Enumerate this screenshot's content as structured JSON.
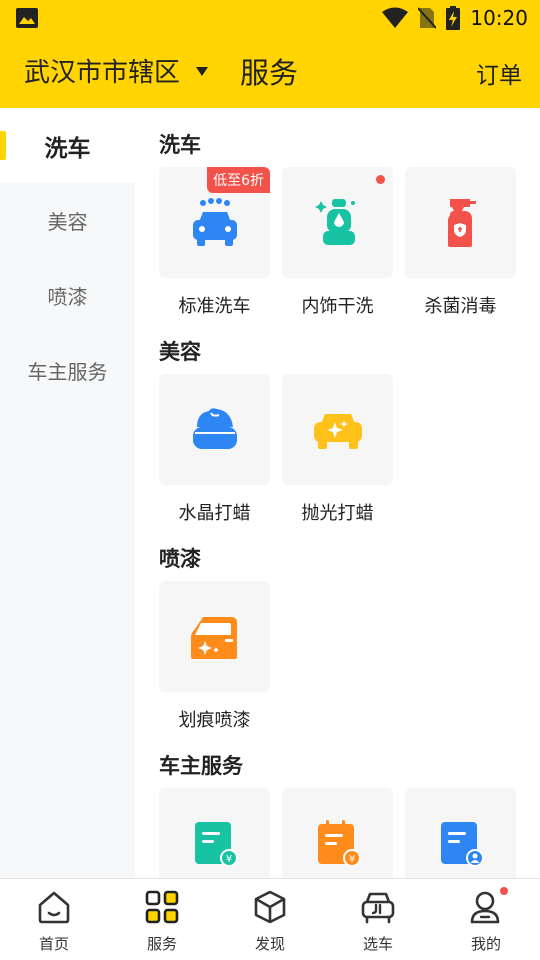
{
  "status_bar": {
    "time": "10:20"
  },
  "header": {
    "city": "武汉市市辖区",
    "title": "服务",
    "orders": "订单"
  },
  "sidebar": {
    "items": [
      {
        "label": "洗车",
        "active": true
      },
      {
        "label": "美容",
        "active": false
      },
      {
        "label": "喷漆",
        "active": false
      },
      {
        "label": "车主服务",
        "active": false
      }
    ]
  },
  "sections": [
    {
      "title": "洗车",
      "items": [
        {
          "label": "标准洗车",
          "badge": "低至6折",
          "icon": "car-wash-icon"
        },
        {
          "label": "内饰干洗",
          "icon": "car-seat-icon"
        },
        {
          "label": "杀菌消毒",
          "icon": "disinfect-spray-icon"
        }
      ]
    },
    {
      "title": "美容",
      "items": [
        {
          "label": "水晶打蜡",
          "icon": "wax-jar-icon"
        },
        {
          "label": "抛光打蜡",
          "icon": "polish-car-icon"
        }
      ]
    },
    {
      "title": "喷漆",
      "items": [
        {
          "label": "划痕喷漆",
          "icon": "car-door-paint-icon"
        }
      ]
    },
    {
      "title": "车主服务",
      "items": [
        {
          "label": "",
          "icon": "invoice-green-icon"
        },
        {
          "label": "",
          "icon": "invoice-orange-icon"
        },
        {
          "label": "",
          "icon": "profile-doc-icon"
        }
      ]
    }
  ],
  "bottom_nav": [
    {
      "label": "首页",
      "icon": "home-icon"
    },
    {
      "label": "服务",
      "icon": "grid-icon",
      "active": true
    },
    {
      "label": "发现",
      "icon": "cube-icon"
    },
    {
      "label": "选车",
      "icon": "car-select-icon"
    },
    {
      "label": "我的",
      "icon": "profile-icon",
      "dot": true
    }
  ],
  "colors": {
    "brand_yellow": "#FFD400",
    "blue": "#2E86F5",
    "green": "#17C3A2",
    "red": "#F2524A",
    "orange": "#FF8C1A",
    "amber": "#FFC21A"
  }
}
